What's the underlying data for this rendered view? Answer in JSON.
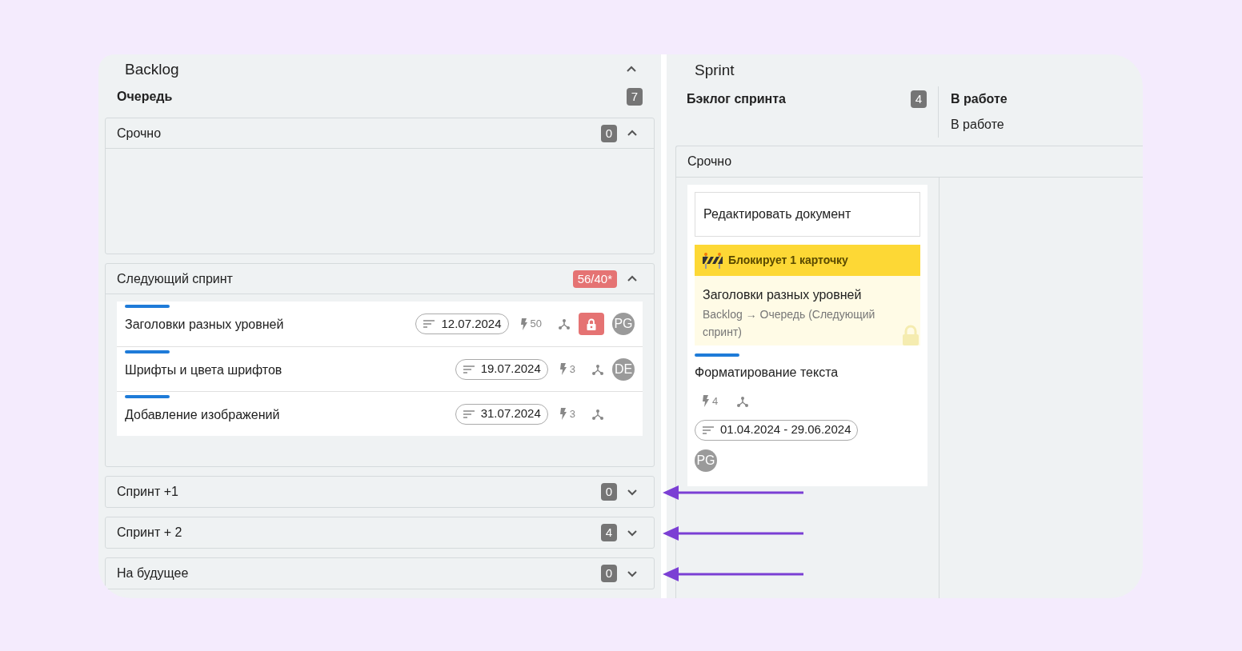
{
  "backlog": {
    "title": "Backlog",
    "expanded": true,
    "queue": {
      "label": "Очередь",
      "count": "7"
    },
    "groups": [
      {
        "title": "Срочно",
        "count": "0",
        "over_limit": false,
        "expanded": true,
        "marked": false
      },
      {
        "title": "Следующий спринт",
        "count": "56/40*",
        "over_limit": true,
        "expanded": true,
        "marked": false,
        "cards": [
          {
            "title": "Заголовки разных уровней",
            "date": "12.07.2024",
            "points": "50",
            "locked": true,
            "avatar": "PG"
          },
          {
            "title": "Шрифты и цвета шрифтов",
            "date": "19.07.2024",
            "points": "3",
            "locked": false,
            "avatar": "DE"
          },
          {
            "title": "Добавление изображений",
            "date": "31.07.2024",
            "points": "3",
            "locked": false
          }
        ]
      },
      {
        "title": "Спринт +1",
        "count": "0",
        "over_limit": false,
        "expanded": false,
        "marked": true
      },
      {
        "title": "Спринт + 2",
        "count": "4",
        "over_limit": false,
        "expanded": false,
        "marked": true
      },
      {
        "title": "На будущее",
        "count": "0",
        "over_limit": false,
        "expanded": false,
        "marked": true
      }
    ]
  },
  "sprint": {
    "title": "Sprint",
    "columns": [
      {
        "title": "Бэклог спринта",
        "count": "4"
      },
      {
        "title": "В работе",
        "subtitle": "В работе"
      }
    ],
    "lane": {
      "title": "Срочно",
      "card": {
        "field_value": "Редактировать документ",
        "blocker": {
          "label": "Блокирует 1 карточку",
          "title": "Заголовки разных уровней",
          "path": "Backlog → Очередь (Следующий спринт)"
        },
        "title": "Форматирование текста",
        "points": "4",
        "date": "01.04.2024 - 29.06.2024",
        "avatar": "PG"
      }
    }
  }
}
